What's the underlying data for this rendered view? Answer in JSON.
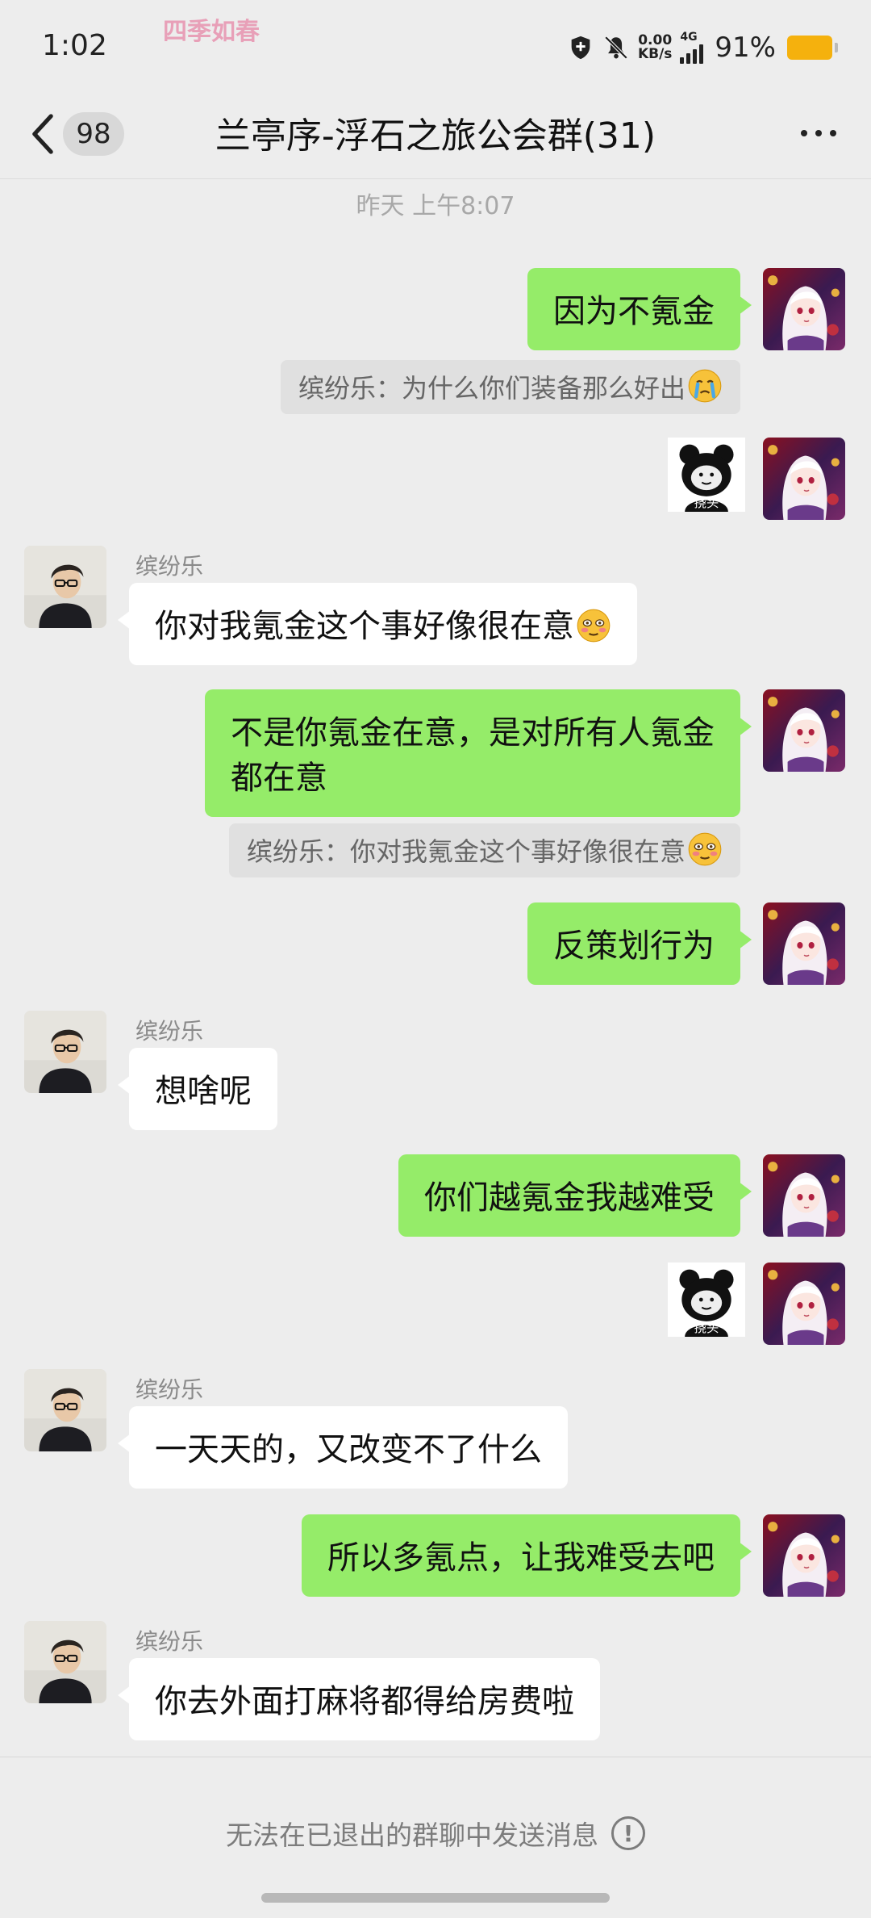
{
  "status_bar": {
    "time": "1:02",
    "overlay_text": "四季如春",
    "speed_value": "0.00",
    "speed_unit": "KB/s",
    "network": "4G",
    "battery_pct": "91%",
    "battery_color": "#f5b10d"
  },
  "header": {
    "unread_count": "98",
    "title": "兰亭序-浮石之旅公会群(31)"
  },
  "timestamp": "昨天 上午8:07",
  "messages": [
    {
      "from": "self",
      "text": "因为不氪金"
    },
    {
      "from": "self",
      "quote": "缤纷乐：为什么你们装备那么好出",
      "emoji": "crying-face"
    },
    {
      "from": "self",
      "sticker": "挠头"
    },
    {
      "from": "other",
      "sender": "缤纷乐",
      "text": "你对我氪金这个事好像很在意",
      "emoji": "flushed-face"
    },
    {
      "from": "self",
      "text_line1": "不是你氪金在意，是对所有人氪金",
      "text_line2": "都在意"
    },
    {
      "from": "self",
      "quote": "缤纷乐：你对我氪金这个事好像很在意",
      "emoji": "flushed-face"
    },
    {
      "from": "self",
      "text": "反策划行为"
    },
    {
      "from": "other",
      "sender": "缤纷乐",
      "text": "想啥呢"
    },
    {
      "from": "self",
      "text": "你们越氪金我越难受"
    },
    {
      "from": "self",
      "sticker": "挠头"
    },
    {
      "from": "other",
      "sender": "缤纷乐",
      "text": "一天天的，又改变不了什么"
    },
    {
      "from": "self",
      "text": "所以多氪点，让我难受去吧"
    },
    {
      "from": "other",
      "sender": "缤纷乐",
      "text": "你去外面打麻将都得给房费啦"
    }
  ],
  "footer": {
    "notice": "无法在已退出的群聊中发送消息",
    "info_icon": "!"
  },
  "colors": {
    "self_bubble": "#95ec69",
    "other_bubble": "#ffffff",
    "background": "#ededed"
  }
}
